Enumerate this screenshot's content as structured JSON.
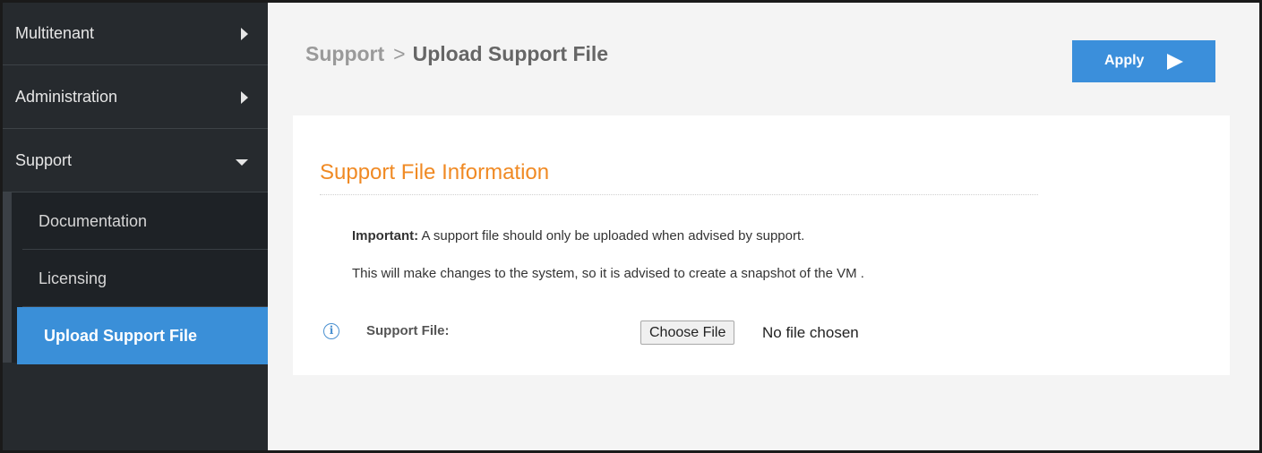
{
  "sidebar": {
    "items": [
      {
        "label": "Multitenant",
        "icon": "chevron-right-icon"
      },
      {
        "label": "Administration",
        "icon": "chevron-right-icon"
      },
      {
        "label": "Support",
        "icon": "chevron-down-icon"
      }
    ],
    "subitems": [
      {
        "label": "Documentation"
      },
      {
        "label": "Licensing"
      },
      {
        "label": "Upload Support File",
        "active": true
      }
    ]
  },
  "header": {
    "breadcrumb_parent": "Support",
    "breadcrumb_separator": ">",
    "breadcrumb_current": "Upload Support File",
    "apply_label": "Apply"
  },
  "panel": {
    "section_title": "Support File Information",
    "important_prefix": "Important:",
    "important_text": " A support file should only be uploaded when advised by support.",
    "advice_text": "This will make changes to the system, so it is advised to create a snapshot of the VM .",
    "field_label": "Support File:",
    "info_glyph": "i",
    "choose_file_label": "Choose File",
    "file_status": "No file chosen"
  },
  "colors": {
    "accent": "#3b8fdb",
    "section_title": "#f08a24",
    "sidebar_bg": "#262a2e"
  }
}
